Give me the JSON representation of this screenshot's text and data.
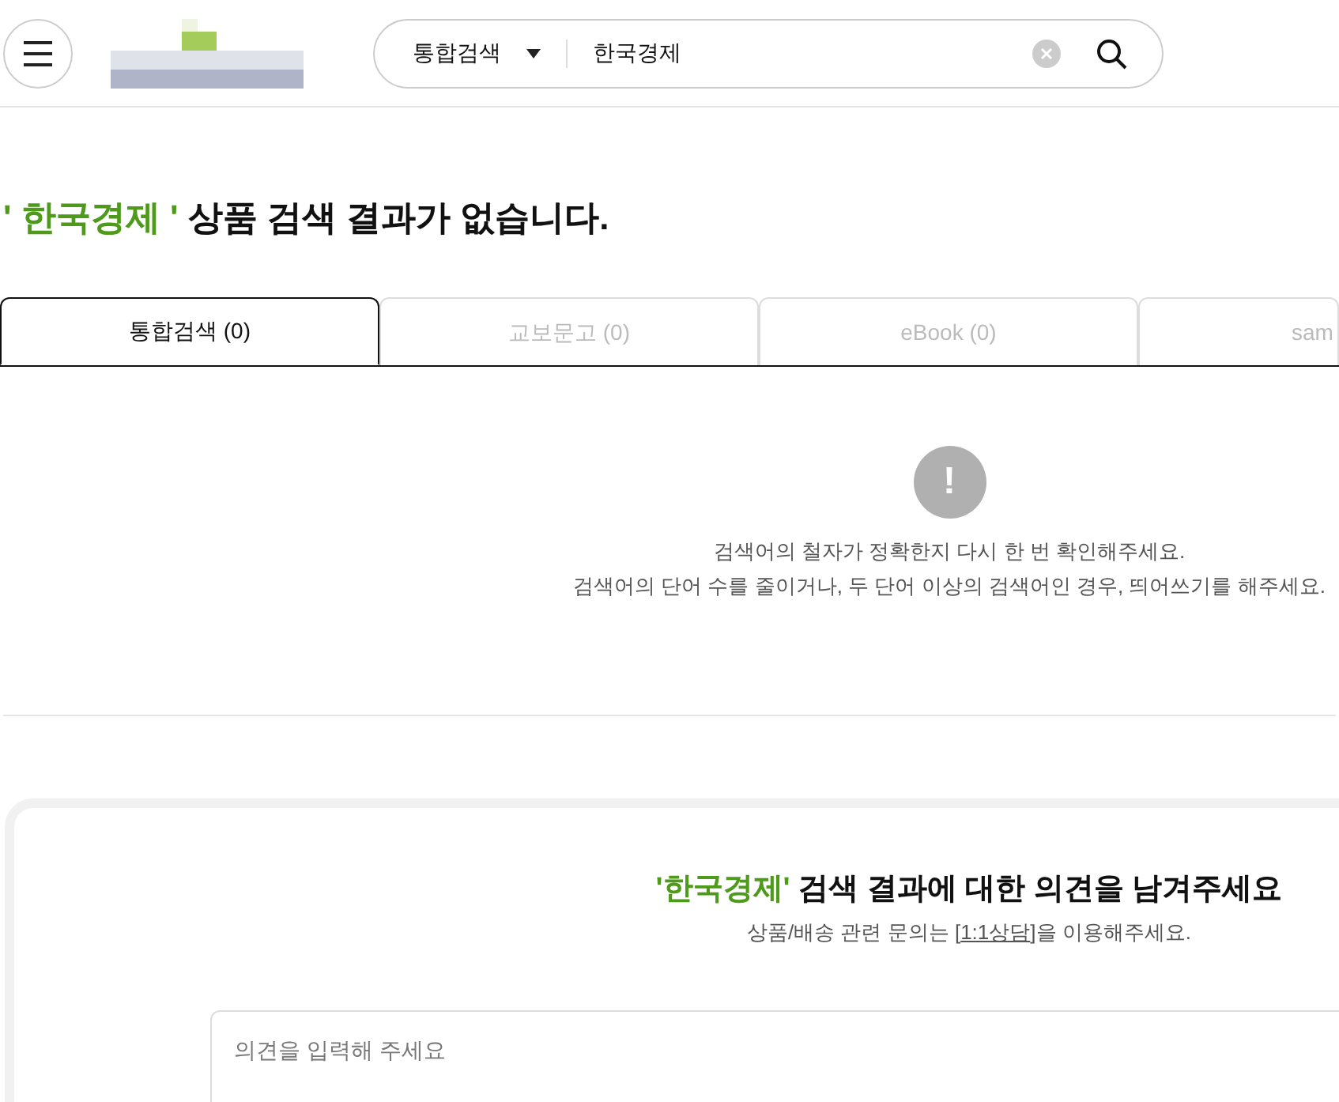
{
  "header": {
    "search": {
      "scope": "통합검색",
      "value": "한국경제"
    }
  },
  "heading": {
    "highlight": "' 한국경제 '",
    "text": "상품 검색 결과가 없습니다."
  },
  "tabs": [
    {
      "label": "통합검색 (0)",
      "selected": true
    },
    {
      "label": "교보문고 (0)",
      "selected": false
    },
    {
      "label": "eBook (0)",
      "selected": false
    },
    {
      "label": "sam",
      "selected": false
    }
  ],
  "empty_state": {
    "icon": "!",
    "lines": [
      "검색어의 철자가 정확한지 다시 한 번 확인해주세요.",
      "검색어의 단어 수를 줄이거나, 두 단어 이상의 검색어인 경우, 띄어쓰기를 해주세요."
    ]
  },
  "feedback": {
    "title_highlight": "'한국경제'",
    "title": "검색 결과에 대한 의견을 남겨주세요",
    "note_before": "상품/배송 관련 문의는 [",
    "note_link": "1:1상담",
    "note_after": "]을 이용해주세요.",
    "placeholder": "의견을 입력해 주세요"
  }
}
